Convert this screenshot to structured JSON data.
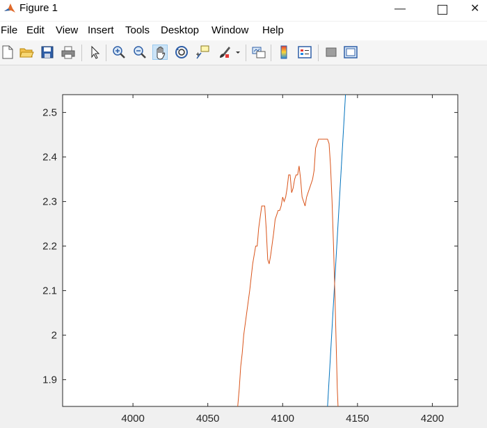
{
  "window": {
    "title": "Figure 1",
    "minimize_glyph": "—",
    "close_glyph": "✕"
  },
  "menu": {
    "items": [
      "File",
      "Edit",
      "View",
      "Insert",
      "Tools",
      "Desktop",
      "Window",
      "Help"
    ]
  },
  "toolbar": {
    "tools": [
      {
        "name": "new-figure-icon"
      },
      {
        "name": "open-file-icon"
      },
      {
        "name": "save-icon"
      },
      {
        "name": "print-icon"
      },
      {
        "name": "select-arrow-icon"
      },
      {
        "name": "zoom-in-icon"
      },
      {
        "name": "zoom-out-icon"
      },
      {
        "name": "pan-hand-icon",
        "active": true
      },
      {
        "name": "rotate-3d-icon"
      },
      {
        "name": "data-cursor-icon"
      },
      {
        "name": "brush-icon"
      },
      {
        "name": "link-plot-icon"
      },
      {
        "name": "colorbar-icon"
      },
      {
        "name": "legend-icon"
      },
      {
        "name": "hide-plot-tools-icon"
      },
      {
        "name": "show-plot-tools-icon"
      }
    ]
  },
  "chart_data": {
    "type": "line",
    "title": "",
    "xlabel": "",
    "ylabel": "",
    "xlim": [
      3953,
      4217
    ],
    "ylim": [
      1.84,
      2.54
    ],
    "xticks": [
      4000,
      4050,
      4100,
      4150,
      4200
    ],
    "yticks": [
      1.9,
      2.0,
      2.1,
      2.2,
      2.3,
      2.4,
      2.5
    ],
    "grid": false,
    "legend": "none",
    "series": [
      {
        "color": "#0072BD",
        "x": [
          4130,
          4142
        ],
        "y": [
          1.84,
          2.54
        ]
      },
      {
        "color": "#D95319",
        "x": [
          4070,
          4071,
          4072,
          4073,
          4074,
          4076,
          4078,
          4080,
          4082,
          4083,
          4084,
          4086,
          4087,
          4088,
          4089,
          4090,
          4091,
          4092,
          4094,
          4095,
          4096,
          4097,
          4098,
          4099,
          4100,
          4101,
          4102,
          4103,
          4104,
          4105,
          4106,
          4107,
          4108,
          4109,
          4110,
          4111,
          4112,
          4113,
          4114,
          4115,
          4116,
          4117,
          4118,
          4120,
          4121,
          4122,
          4124,
          4126,
          4127,
          4128,
          4130,
          4131,
          4132,
          4133,
          4134,
          4135,
          4136,
          4136.5,
          4137
        ],
        "y": [
          1.84,
          1.88,
          1.93,
          1.96,
          2.0,
          2.05,
          2.1,
          2.16,
          2.2,
          2.2,
          2.24,
          2.29,
          2.29,
          2.29,
          2.24,
          2.17,
          2.16,
          2.18,
          2.23,
          2.26,
          2.27,
          2.28,
          2.28,
          2.29,
          2.31,
          2.3,
          2.31,
          2.33,
          2.36,
          2.36,
          2.32,
          2.33,
          2.35,
          2.36,
          2.36,
          2.38,
          2.35,
          2.31,
          2.3,
          2.29,
          2.31,
          2.32,
          2.33,
          2.35,
          2.37,
          2.42,
          2.44,
          2.44,
          2.44,
          2.44,
          2.44,
          2.43,
          2.38,
          2.3,
          2.2,
          2.08,
          1.95,
          1.88,
          1.84
        ]
      }
    ]
  }
}
